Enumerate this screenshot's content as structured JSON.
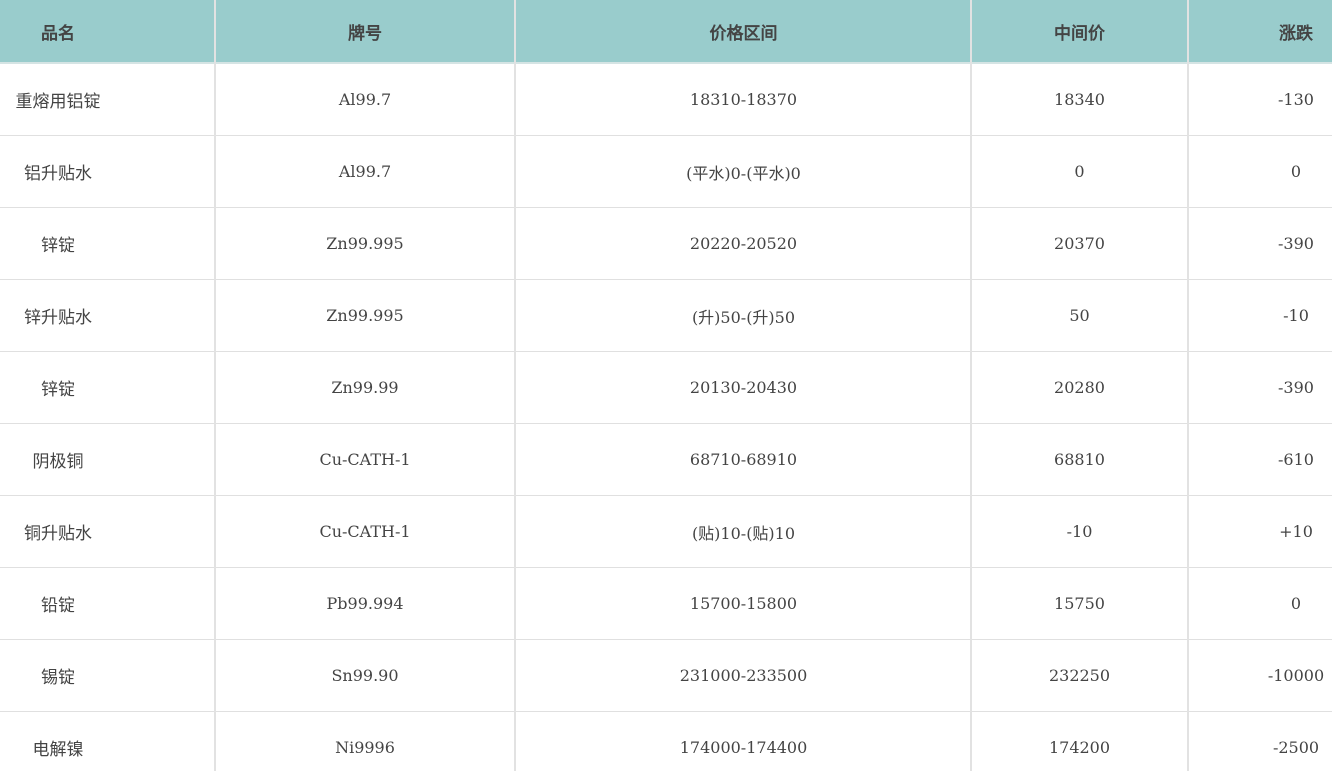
{
  "table": {
    "headers": [
      "品名",
      "牌号",
      "价格区间",
      "中间价",
      "涨跌"
    ],
    "rows": [
      [
        "重熔用铝锭",
        "Al99.7",
        "18310-18370",
        "18340",
        "-130"
      ],
      [
        "铝升贴水",
        "Al99.7",
        "(平水)0-(平水)0",
        "0",
        "0"
      ],
      [
        "锌锭",
        "Zn99.995",
        "20220-20520",
        "20370",
        "-390"
      ],
      [
        "锌升贴水",
        "Zn99.995",
        "(升)50-(升)50",
        "50",
        "-10"
      ],
      [
        "锌锭",
        "Zn99.99",
        "20130-20430",
        "20280",
        "-390"
      ],
      [
        "阴极铜",
        "Cu-CATH-1",
        "68710-68910",
        "68810",
        "-610"
      ],
      [
        "铜升贴水",
        "Cu-CATH-1",
        "(贴)10-(贴)10",
        "-10",
        "+10"
      ],
      [
        "铅锭",
        "Pb99.994",
        "15700-15800",
        "15750",
        "0"
      ],
      [
        "锡锭",
        "Sn99.90",
        "231000-233500",
        "232250",
        "-10000"
      ],
      [
        "电解镍",
        "Ni9996",
        "174000-174400",
        "174200",
        "-2500"
      ]
    ]
  },
  "colors": {
    "header_bg": "#99cccc",
    "grid_line": "#e0e0e0"
  }
}
